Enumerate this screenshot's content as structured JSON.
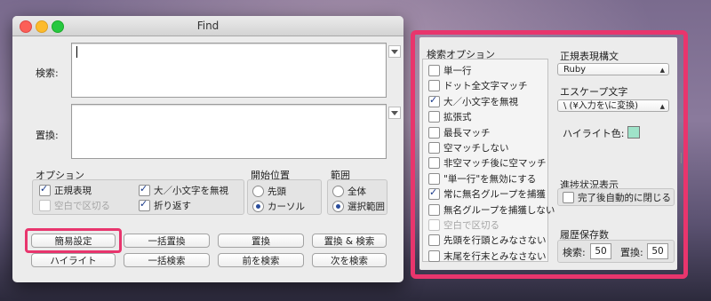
{
  "window": {
    "title": "Find"
  },
  "find": {
    "search_label": "検索:",
    "replace_label": "置換:",
    "search_value": "",
    "replace_value": ""
  },
  "options": {
    "title": "オプション",
    "regex": "正規表現",
    "regex_checked": true,
    "ignore_case": "大／小文字を無視",
    "ignore_case_checked": true,
    "split_space": "空白で区切る",
    "split_space_checked": false,
    "wrap": "折り返す",
    "wrap_checked": true
  },
  "start": {
    "title": "開始位置",
    "top": "先頭",
    "cursor": "カーソル",
    "selected": "cursor"
  },
  "range": {
    "title": "範囲",
    "all": "全体",
    "selection": "選択範囲",
    "selected": "selection"
  },
  "buttons": {
    "simple": "簡易設定",
    "replace_all": "一括置換",
    "replace": "置換",
    "replace_find": "置換 & 検索",
    "highlight": "ハイライト",
    "find_all": "一括検索",
    "find_prev": "前を検索",
    "find_next": "次を検索"
  },
  "panel": {
    "search_options_title": "検索オプション",
    "items": [
      {
        "label": "単一行",
        "checked": false,
        "disabled": false
      },
      {
        "label": "ドット全文字マッチ",
        "checked": false,
        "disabled": false
      },
      {
        "label": "大／小文字を無視",
        "checked": true,
        "disabled": false
      },
      {
        "label": "拡張式",
        "checked": false,
        "disabled": false
      },
      {
        "label": "最長マッチ",
        "checked": false,
        "disabled": false
      },
      {
        "label": "空マッチしない",
        "checked": false,
        "disabled": false
      },
      {
        "label": "非空マッチ後に空マッチ",
        "checked": false,
        "disabled": false
      },
      {
        "label": "\"単一行\"を無効にする",
        "checked": false,
        "disabled": false
      },
      {
        "label": "常に無名グループを捕獲",
        "checked": true,
        "disabled": false
      },
      {
        "label": "無名グループを捕獲しない",
        "checked": false,
        "disabled": false
      },
      {
        "label": "空白で区切る",
        "checked": false,
        "disabled": true
      },
      {
        "label": "先頭を行頭とみなさない",
        "checked": false,
        "disabled": false
      },
      {
        "label": "末尾を行末とみなさない",
        "checked": false,
        "disabled": false
      }
    ],
    "syntax_title": "正規表現構文",
    "syntax_value": "Ruby",
    "escape_title": "エスケープ文字",
    "escape_value": "\\ (¥入力を\\に変換)",
    "highlight_color_label": "ハイライト色:",
    "highlight_color": "#9fe3c9",
    "progress_title": "進捗状況表示",
    "close_when_done": "完了後自動的に閉じる",
    "close_when_done_checked": false,
    "history_title": "履歴保存数",
    "search_count_label": "検索:",
    "search_count": "50",
    "replace_count_label": "置換:",
    "replace_count": "50"
  },
  "colors": {
    "highlight_frame": "#e8356d"
  }
}
